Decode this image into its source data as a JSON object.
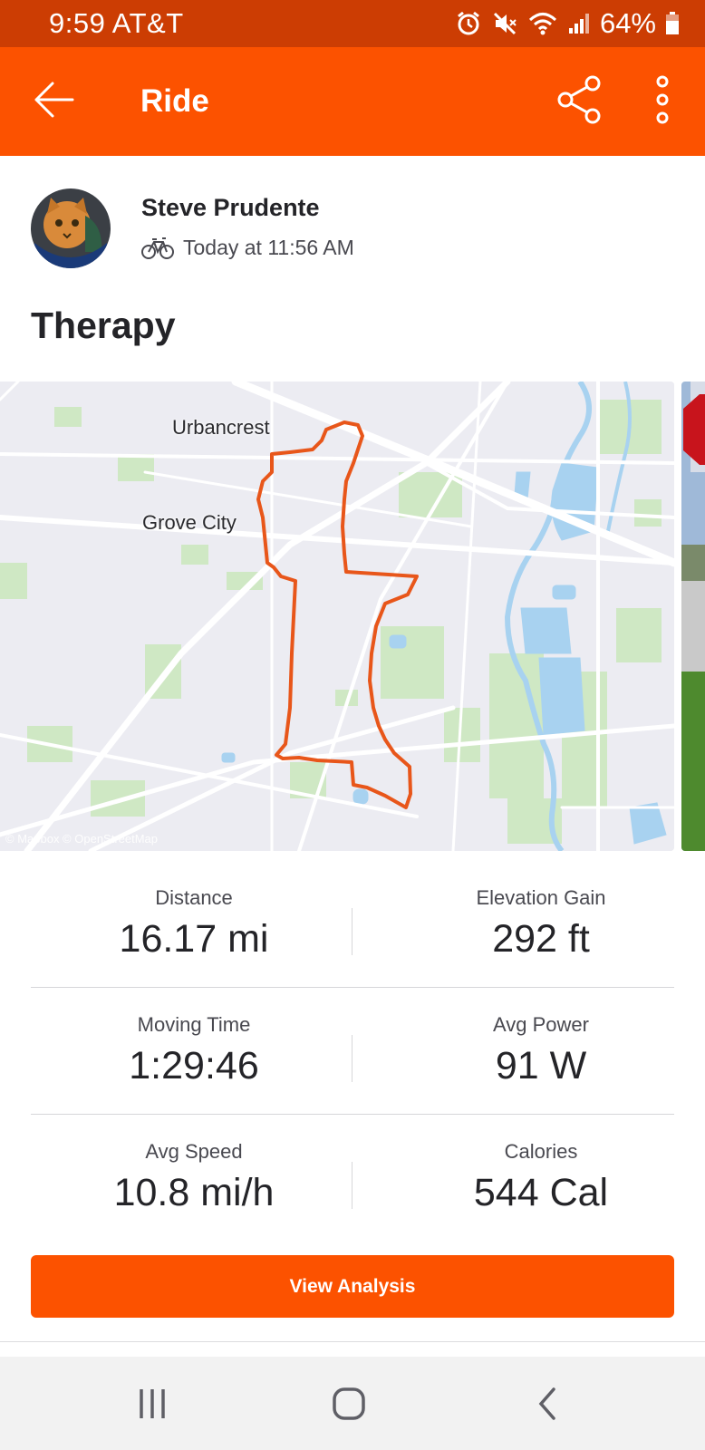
{
  "status_bar": {
    "time": "9:59 AT&T",
    "battery": "64%",
    "icons": [
      "alarm-icon",
      "mute-icon",
      "wifi-icon",
      "signal-icon",
      "battery-icon"
    ]
  },
  "app_bar": {
    "title": "Ride",
    "back_icon": "arrow-left-icon",
    "share_icon": "share-icon",
    "more_icon": "more-vertical-icon"
  },
  "athlete": {
    "name": "Steve Prudente",
    "time": "Today at 11:56 AM",
    "sport_icon": "bike-icon",
    "avatar_badge": "#STAYHOME"
  },
  "activity": {
    "title": "Therapy"
  },
  "map": {
    "labels": {
      "urbancrest": "Urbancrest",
      "grove_city": "Grove City"
    },
    "attribution": "© Mapbox © OpenStreetMap",
    "route_color": "#e8561a"
  },
  "stats": [
    {
      "left": {
        "label": "Distance",
        "value": "16.17 mi"
      },
      "right": {
        "label": "Elevation Gain",
        "value": "292 ft"
      }
    },
    {
      "left": {
        "label": "Moving Time",
        "value": "1:29:46"
      },
      "right": {
        "label": "Avg Power",
        "value": "91 W"
      }
    },
    {
      "left": {
        "label": "Avg Speed",
        "value": "10.8 mi/h"
      },
      "right": {
        "label": "Calories",
        "value": "544 Cal"
      }
    }
  ],
  "actions": {
    "view_analysis": "View Analysis"
  },
  "nav": {
    "recents_icon": "recents-icon",
    "home_icon": "home-icon",
    "back_icon": "chevron-left-icon"
  },
  "colors": {
    "brand": "#fc5200",
    "status_bar": "#cc3d03",
    "water": "#a8d2f0",
    "park": "#cfe8c4"
  }
}
